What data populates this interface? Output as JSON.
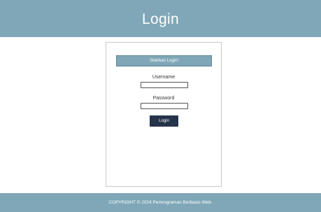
{
  "header": {
    "title": "Login"
  },
  "login_form": {
    "banner": "Silahkan Login!",
    "username_label": "Username",
    "username_value": "",
    "password_label": "Password",
    "password_value": "",
    "submit_label": "Login"
  },
  "footer": {
    "copyright": "COPYRIGHT © 2024 Pemrograman Berbasis Web."
  },
  "colors": {
    "header_background": "#7fa7b7",
    "button_background": "#25344a",
    "text": "#333333"
  }
}
